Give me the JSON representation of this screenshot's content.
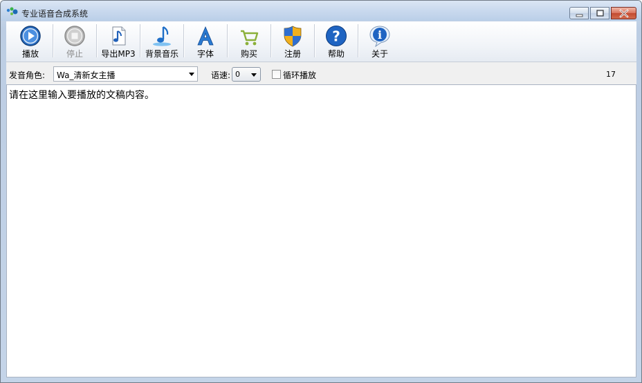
{
  "window": {
    "title": "专业语音合成系统"
  },
  "toolbar": {
    "buttons": [
      {
        "label": "播放",
        "icon": "play-icon"
      },
      {
        "label": "停止",
        "icon": "stop-icon"
      },
      {
        "label": "导出MP3",
        "icon": "export-mp3-icon"
      },
      {
        "label": "背景音乐",
        "icon": "music-note-icon"
      },
      {
        "label": "字体",
        "icon": "font-icon"
      },
      {
        "label": "购买",
        "icon": "cart-icon"
      },
      {
        "label": "注册",
        "icon": "shield-icon"
      },
      {
        "label": "帮助",
        "icon": "help-icon"
      },
      {
        "label": "关于",
        "icon": "info-icon"
      }
    ]
  },
  "options": {
    "voice_label": "发音角色:",
    "voice_value": "Wa_清新女主播",
    "speed_label": "语速:",
    "speed_value": "0",
    "loop_label": "循环播放",
    "loop_checked": false,
    "char_count": "17"
  },
  "editor": {
    "text": "请在这里输入要播放的文稿内容。"
  },
  "colors": {
    "accent_blue": "#1f5fb8",
    "stop_gray": "#9a9a9a",
    "cart_green": "#8bb03a"
  }
}
